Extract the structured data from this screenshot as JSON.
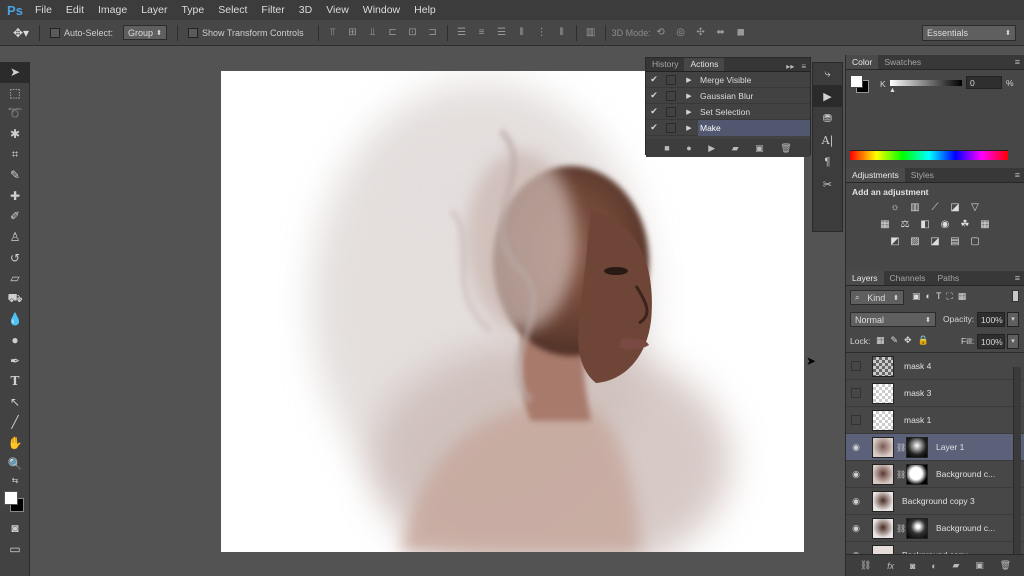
{
  "app": {
    "logo": "Ps"
  },
  "menu": [
    "File",
    "Edit",
    "Image",
    "Layer",
    "Type",
    "Select",
    "Filter",
    "3D",
    "View",
    "Window",
    "Help"
  ],
  "options": {
    "auto_select_label": "Auto-Select:",
    "auto_select_value": "Group",
    "show_transform_label": "Show Transform Controls",
    "mode_3d_label": "3D Mode:",
    "workspace": "Essentials"
  },
  "actions_panel": {
    "tabs": [
      "History",
      "Actions"
    ],
    "active_tab": "Actions",
    "items": [
      "Merge Visible",
      "Gaussian Blur",
      "Set Selection",
      "Make"
    ],
    "selected_index": 3
  },
  "color_panel": {
    "tabs": [
      "Color",
      "Swatches"
    ],
    "channel_label": "K",
    "value": "0",
    "unit": "%"
  },
  "adjustments_panel": {
    "tabs": [
      "Adjustments",
      "Styles"
    ],
    "heading": "Add an adjustment"
  },
  "layers_panel": {
    "tabs": [
      "Layers",
      "Channels",
      "Paths"
    ],
    "kind_label": "Kind",
    "blend_mode": "Normal",
    "opacity_label": "Opacity:",
    "opacity_value": "100%",
    "lock_label": "Lock:",
    "fill_label": "Fill:",
    "fill_value": "100%",
    "layers": [
      {
        "name": "mask 4",
        "visible": false
      },
      {
        "name": "mask 3",
        "visible": false
      },
      {
        "name": "mask 1",
        "visible": false
      },
      {
        "name": "Layer 1",
        "visible": true
      },
      {
        "name": "Background c...",
        "visible": true
      },
      {
        "name": "Background copy 3",
        "visible": true
      },
      {
        "name": "Background c...",
        "visible": true
      },
      {
        "name": "Background copy",
        "visible": true
      }
    ],
    "selected_index": 3
  },
  "colors": {
    "accent_selected": "#5b6179",
    "ps_blue": "#4ba3e2"
  }
}
